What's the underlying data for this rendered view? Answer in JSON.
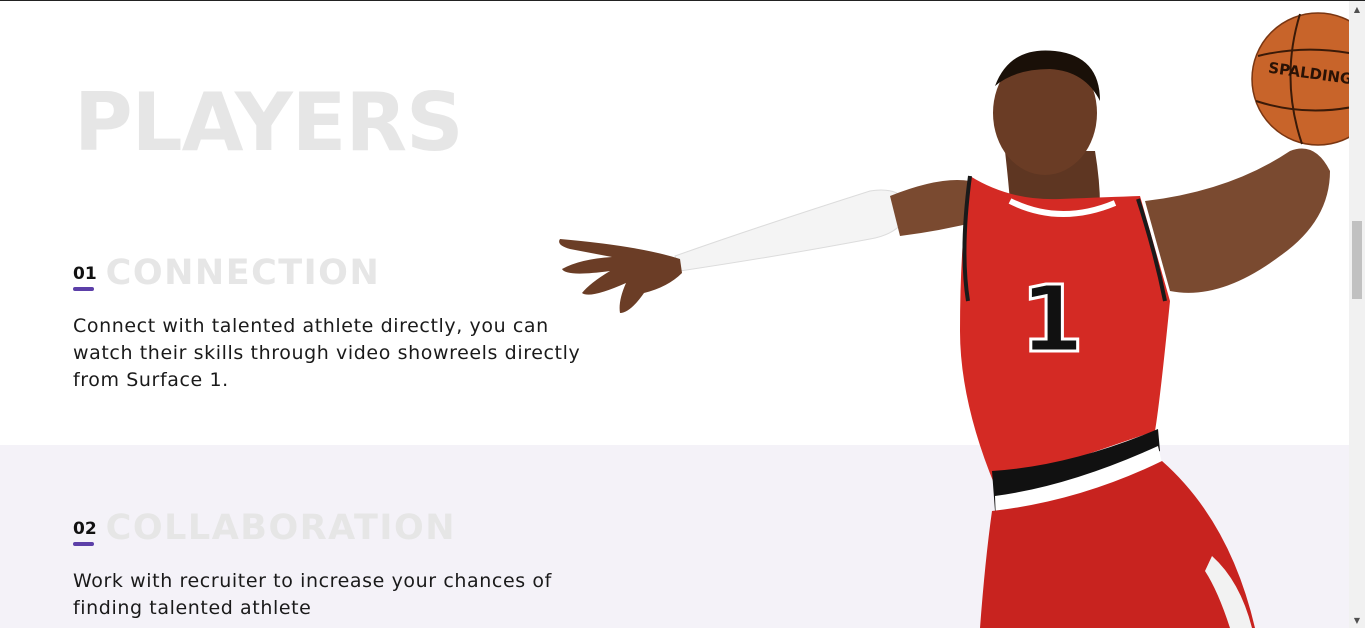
{
  "section": {
    "title": "PLAYERS"
  },
  "features": [
    {
      "number": "01",
      "title": "CONNECTION",
      "description": "Connect with talented athlete directly, you can watch their skills through video showreels directly from Surface 1."
    },
    {
      "number": "02",
      "title": "COLLABORATION",
      "description": "Work with recruiter to increase your chances of finding talented athlete"
    }
  ],
  "hero": {
    "jersey_number": "1",
    "ball_brand": "SPALDING"
  },
  "colors": {
    "accent": "#5c3fa8",
    "jersey": "#d42a24",
    "band": "#f4f2f8",
    "heading": "#e6e6e6"
  }
}
